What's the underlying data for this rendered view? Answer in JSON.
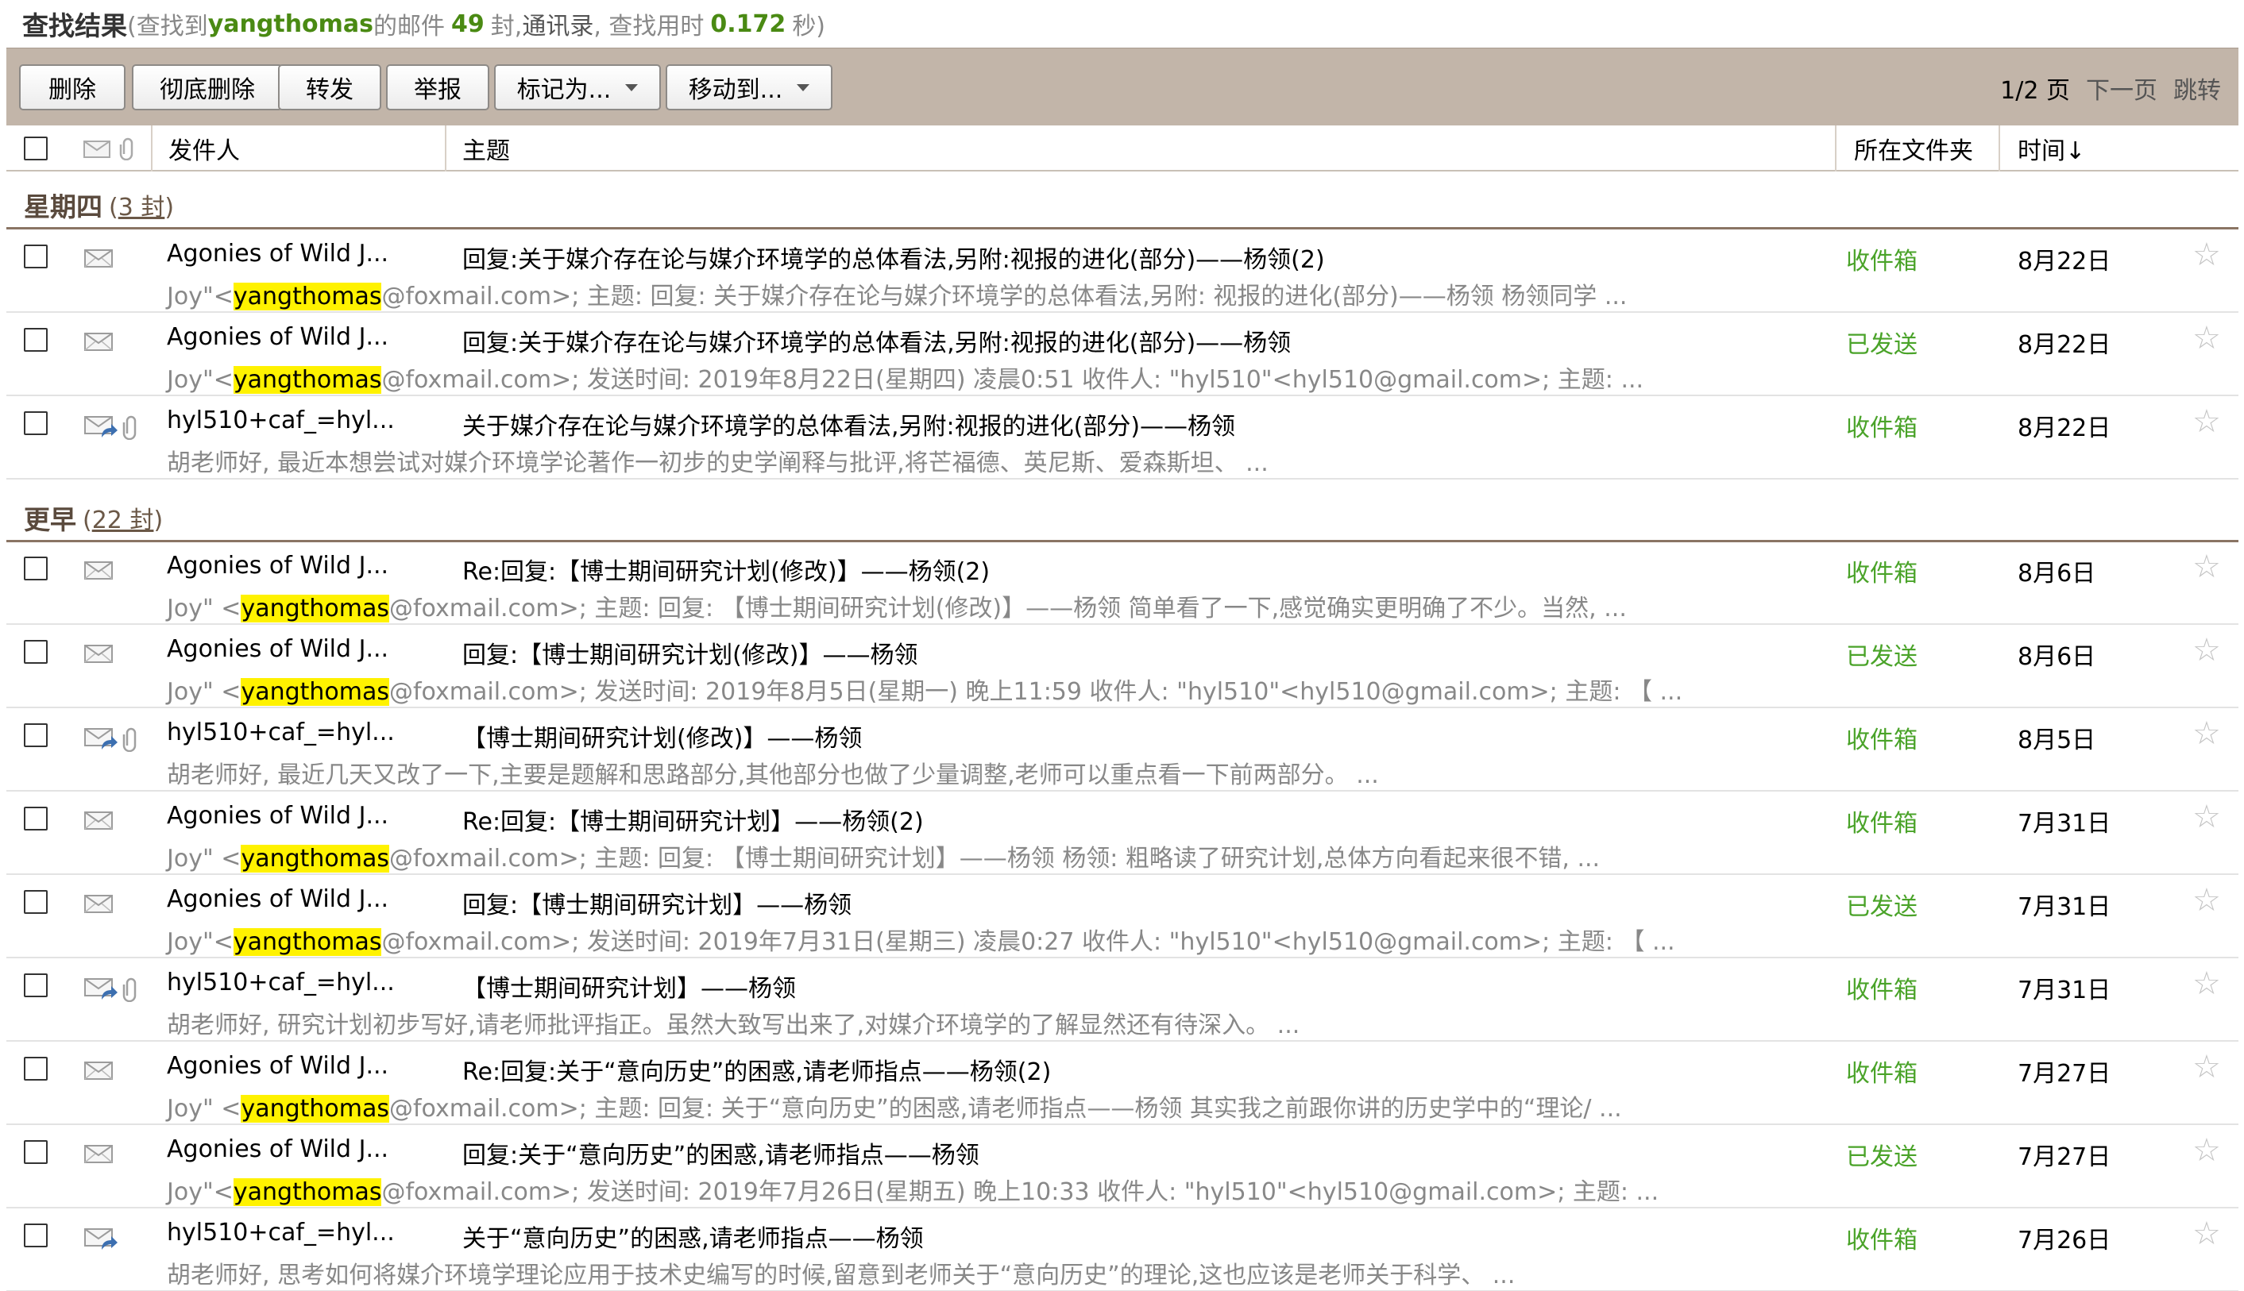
{
  "header": {
    "title": "查找结果",
    "prefix": "(查找到",
    "keyword": "yangthomas",
    "middle": "的邮件",
    "count": "49",
    "unit": "封,",
    "contacts": "通讯录",
    "elapsed_label": ", 查找用时",
    "elapsed": "0.172",
    "suffix": "秒)"
  },
  "toolbar": {
    "delete": "删除",
    "delete_permanent": "彻底删除",
    "forward": "转发",
    "report": "举报",
    "mark_as": "标记为...",
    "move_to": "移动到..."
  },
  "pager": {
    "page": "1/2 页",
    "next": "下一页",
    "jump": "跳转"
  },
  "columns": {
    "sender": "发件人",
    "subject": "主题",
    "folder": "所在文件夹",
    "time": "时间↓"
  },
  "groups": [
    {
      "name": "星期四",
      "count_open": "(",
      "count": "3 封",
      "count_close": ")"
    },
    {
      "name": "更早",
      "count_open": "(",
      "count": "22 封",
      "count_close": ")"
    }
  ],
  "rows": [
    {
      "from": "Agonies of Wild J...",
      "subject": "回复:关于媒介存在论与媒介环境学的总体看法,另附:视报的进化(部分)——杨领(2)",
      "d1": "Joy\"<",
      "hl": "yangthomas",
      "d2": "@foxmail.com>; 主题: 回复: 关于媒介存在论与媒介环境学的总体看法,另附: 视报的进化(部分)——杨领 杨领同学 ...",
      "folder": "收件箱",
      "date": "8月22日",
      "icon": "envelope"
    },
    {
      "from": "Agonies of Wild J...",
      "subject": "回复:关于媒介存在论与媒介环境学的总体看法,另附:视报的进化(部分)——杨领",
      "d1": "Joy\"<",
      "hl": "yangthomas",
      "d2": "@foxmail.com>; 发送时间: 2019年8月22日(星期四) 凌晨0:51 收件人: \"hyl510\"<hyl510@gmail.com>; 主题: ...",
      "folder": "已发送",
      "date": "8月22日",
      "icon": "envelope"
    },
    {
      "from": "hyl510+caf_=hyl...",
      "subject": "关于媒介存在论与媒介环境学的总体看法,另附:视报的进化(部分)——杨领",
      "d1": "胡老师好, 最近本想尝试对媒介环境学论著作一初步的史学阐释与批评,将芒福德、英尼斯、爱森斯坦、 ...",
      "hl": "",
      "d2": "",
      "folder": "收件箱",
      "date": "8月22日",
      "icon": "replied-attach"
    },
    {
      "from": "Agonies of Wild J...",
      "subject": "Re:回复:【博士期间研究计划(修改)】——杨领(2)",
      "d1": "Joy\" <",
      "hl": "yangthomas",
      "d2": "@foxmail.com>; 主题: 回复: 【博士期间研究计划(修改)】——杨领 简单看了一下,感觉确实更明确了不少。当然, ...",
      "folder": "收件箱",
      "date": "8月6日",
      "icon": "envelope"
    },
    {
      "from": "Agonies of Wild J...",
      "subject": "回复:【博士期间研究计划(修改)】——杨领",
      "d1": "Joy\" <",
      "hl": "yangthomas",
      "d2": "@foxmail.com>; 发送时间: 2019年8月5日(星期一) 晚上11:59 收件人: \"hyl510\"<hyl510@gmail.com>; 主题: 【 ...",
      "folder": "已发送",
      "date": "8月6日",
      "icon": "envelope"
    },
    {
      "from": "hyl510+caf_=hyl...",
      "subject": "【博士期间研究计划(修改)】——杨领",
      "d1": "胡老师好, 最近几天又改了一下,主要是题解和思路部分,其他部分也做了少量调整,老师可以重点看一下前两部分。 ...",
      "hl": "",
      "d2": "",
      "folder": "收件箱",
      "date": "8月5日",
      "icon": "replied-attach"
    },
    {
      "from": "Agonies of Wild J...",
      "subject": "Re:回复:【博士期间研究计划】——杨领(2)",
      "d1": "Joy\" <",
      "hl": "yangthomas",
      "d2": "@foxmail.com>; 主题: 回复: 【博士期间研究计划】——杨领 杨领: 粗略读了研究计划,总体方向看起来很不错, ...",
      "folder": "收件箱",
      "date": "7月31日",
      "icon": "envelope"
    },
    {
      "from": "Agonies of Wild J...",
      "subject": "回复:【博士期间研究计划】——杨领",
      "d1": "Joy\"<",
      "hl": "yangthomas",
      "d2": "@foxmail.com>; 发送时间: 2019年7月31日(星期三) 凌晨0:27 收件人: \"hyl510\"<hyl510@gmail.com>; 主题: 【 ...",
      "folder": "已发送",
      "date": "7月31日",
      "icon": "envelope"
    },
    {
      "from": "hyl510+caf_=hyl...",
      "subject": "【博士期间研究计划】——杨领",
      "d1": "胡老师好, 研究计划初步写好,请老师批评指正。虽然大致写出来了,对媒介环境学的了解显然还有待深入。 ...",
      "hl": "",
      "d2": "",
      "folder": "收件箱",
      "date": "7月31日",
      "icon": "replied-attach"
    },
    {
      "from": "Agonies of Wild J...",
      "subject": "Re:回复:关于“意向历史”的困惑,请老师指点——杨领(2)",
      "d1": "Joy\" <",
      "hl": "yangthomas",
      "d2": "@foxmail.com>; 主题: 回复: 关于“意向历史”的困惑,请老师指点——杨领 其实我之前跟你讲的历史学中的“理论/ ...",
      "folder": "收件箱",
      "date": "7月27日",
      "icon": "envelope"
    },
    {
      "from": "Agonies of Wild J...",
      "subject": "回复:关于“意向历史”的困惑,请老师指点——杨领",
      "d1": "Joy\"<",
      "hl": "yangthomas",
      "d2": "@foxmail.com>; 发送时间: 2019年7月26日(星期五) 晚上10:33 收件人: \"hyl510\"<hyl510@gmail.com>; 主题: ...",
      "folder": "已发送",
      "date": "7月27日",
      "icon": "envelope"
    },
    {
      "from": "hyl510+caf_=hyl...",
      "subject": "关于“意向历史”的困惑,请老师指点——杨领",
      "d1": "胡老师好, 思考如何将媒介环境学理论应用于技术史编写的时候,留意到老师关于“意向历史”的理论,这也应该是老师关于科学、 ...",
      "hl": "",
      "d2": "",
      "folder": "收件箱",
      "date": "7月26日",
      "icon": "replied"
    }
  ]
}
